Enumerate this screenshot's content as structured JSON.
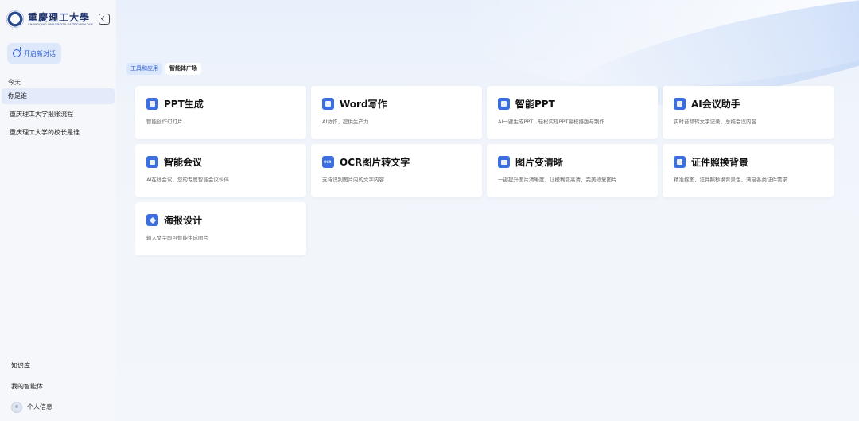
{
  "brand": {
    "name_cn": "重慶理工大學",
    "name_en": "CHONGQING UNIVERSITY OF TECHNOLOGY"
  },
  "sidebar": {
    "new_chat_label": "开启新对话",
    "today_label": "今天",
    "history": [
      {
        "label": "你是谁"
      },
      {
        "label": "重庆理工大学报账流程"
      },
      {
        "label": "重庆理工大学的校长是谁"
      }
    ],
    "bottom": {
      "knowledge_base": "知识库",
      "my_agents": "我的智能体",
      "profile": "个人信息"
    }
  },
  "tabs": [
    {
      "label": "工具和应用"
    },
    {
      "label": "智能体广场"
    }
  ],
  "cards": [
    {
      "title": "PPT生成",
      "desc": "智能创作幻灯片",
      "icon": "document-icon"
    },
    {
      "title": "Word写作",
      "desc": "AI协作、提供生产力",
      "icon": "document-icon"
    },
    {
      "title": "智能PPT",
      "desc": "AI一键生成PPT，轻松实现PPT高校排版与制作",
      "icon": "document-icon"
    },
    {
      "title": "AI会议助手",
      "desc": "实时音频转文字记录、总结会议内容",
      "icon": "monitor-icon"
    },
    {
      "title": "智能会议",
      "desc": "AI在线会议，您的专属智能会议伙伴",
      "icon": "calendar-icon"
    },
    {
      "title": "OCR图片转文字",
      "desc": "支持识别图片内的文字内容",
      "icon": "ocr-icon"
    },
    {
      "title": "图片变清晰",
      "desc": "一键提升图片清晰度，让模糊变高清，完美修复图片",
      "icon": "image-icon"
    },
    {
      "title": "证件照换背景",
      "desc": "精准抠图，证件照秒换背景色，满足各类证件需求",
      "icon": "id-photo-icon"
    },
    {
      "title": "海报设计",
      "desc": "输入文字即可智能生成图片",
      "icon": "poster-icon"
    }
  ],
  "colors": {
    "accent": "#2a5bd7",
    "icon_bg": "#3b6fe0",
    "active_bg": "#dbe7fb"
  }
}
